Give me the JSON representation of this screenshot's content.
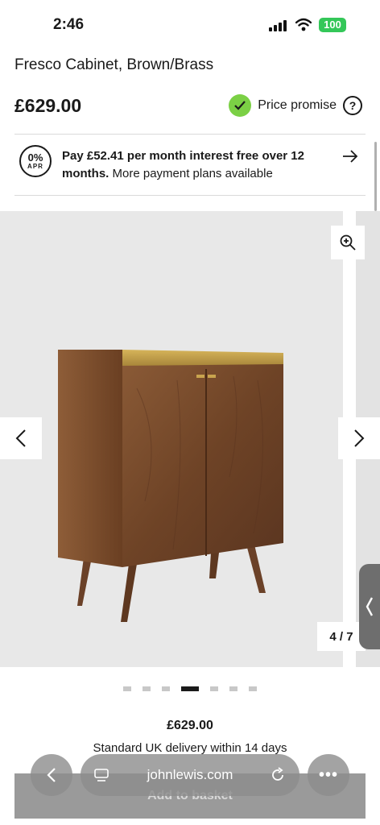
{
  "status": {
    "time": "2:46",
    "battery": "100"
  },
  "product": {
    "title": "Fresco Cabinet, Brown/Brass",
    "price": "£629.00",
    "price_promise": "Price promise",
    "price_promise_help": "?"
  },
  "finance": {
    "apr_pct": "0%",
    "apr_label": "APR",
    "text_bold": "Pay £52.41 per month interest free over 12 months.",
    "text_rest": " More payment plans available"
  },
  "gallery": {
    "counter": "4 / 7",
    "dots_total": 7,
    "active_index": 3
  },
  "summary": {
    "price": "£629.00",
    "delivery": "Standard UK delivery within 14 days",
    "add_button": "Add to basket"
  },
  "browser": {
    "url": "johnlewis.com"
  },
  "colors": {
    "promise_green": "#7bd045",
    "battery_green": "#34c759"
  }
}
